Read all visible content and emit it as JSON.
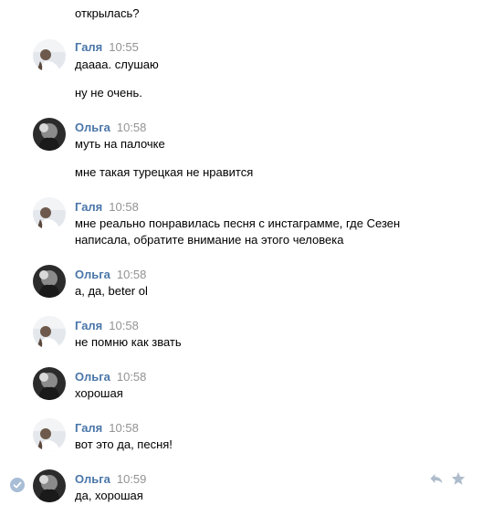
{
  "messages": [
    {
      "text": "открылась?"
    },
    {
      "author": "Галя",
      "time": "10:55",
      "lines": [
        "даааа. слушаю",
        "ну не очень."
      ]
    },
    {
      "author": "Ольга",
      "time": "10:58",
      "lines": [
        "муть на палочке",
        "мне такая турецкая не нравится"
      ]
    },
    {
      "author": "Галя",
      "time": "10:58",
      "lines": [
        "мне реально понравилась песня с инстаграмме, где Сезен написала, обратите внимание на этого человека"
      ]
    },
    {
      "author": "Ольга",
      "time": "10:58",
      "lines": [
        "а, да, beter ol"
      ]
    },
    {
      "author": "Галя",
      "time": "10:58",
      "lines": [
        "не помню как звать"
      ]
    },
    {
      "author": "Ольга",
      "time": "10:58",
      "lines": [
        "хорошая"
      ]
    },
    {
      "author": "Галя",
      "time": "10:58",
      "lines": [
        "вот это да, песня!"
      ]
    },
    {
      "author": "Ольга",
      "time": "10:59",
      "lines": [
        "да, хорошая"
      ]
    }
  ],
  "actions": {
    "reply_icon": "reply-icon",
    "star_icon": "star-icon",
    "check_icon": "check-icon"
  },
  "colors": {
    "author": "#4a76a8",
    "time": "#939393",
    "text": "#000000",
    "check": "#a8bdd6",
    "action_icons": "#aebccb"
  }
}
